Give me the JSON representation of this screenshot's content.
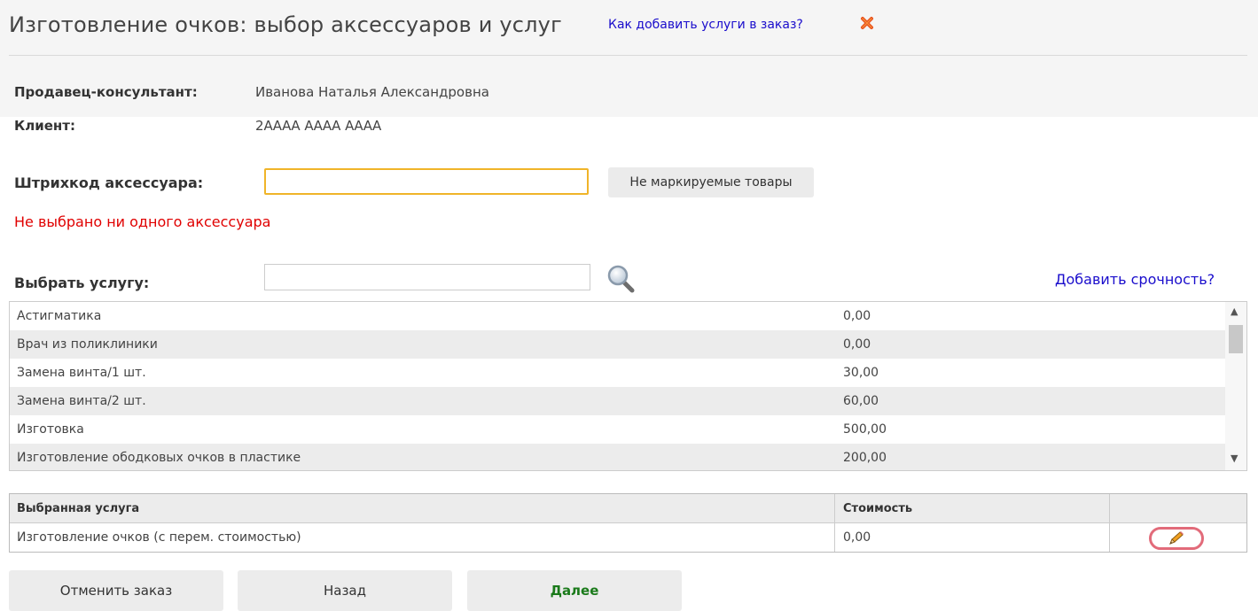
{
  "header": {
    "title": "Изготовление очков: выбор аксессуаров и услуг",
    "help_link": "Как добавить услуги в заказ?",
    "close_icon": "close-x-icon"
  },
  "info": {
    "seller_label": "Продавец-консультант:",
    "seller_value": "Иванова Наталья Александровна",
    "client_label": "Клиент:",
    "client_value": "2АААА АААА АААА"
  },
  "accessory": {
    "barcode_label": "Штрихкод аксессуара:",
    "barcode_value": "",
    "unmarked_button": "Не маркируемые товары",
    "error": "Не выбрано ни одного аксессуара"
  },
  "service": {
    "label": "Выбрать услугу:",
    "search_value": "",
    "search_icon": "magnifier-icon",
    "urgency_link": "Добавить срочность?",
    "list": [
      {
        "name": "Астигматика",
        "price": "0,00"
      },
      {
        "name": "Врач из поликлиники",
        "price": "0,00"
      },
      {
        "name": "Замена винта/1 шт.",
        "price": "30,00"
      },
      {
        "name": "Замена винта/2 шт.",
        "price": "60,00"
      },
      {
        "name": "Изготовка",
        "price": "500,00"
      },
      {
        "name": "Изготовление ободковых очков в пластике",
        "price": "200,00"
      }
    ]
  },
  "selected": {
    "col_service": "Выбранная услуга",
    "col_cost": "Стоимость",
    "rows": [
      {
        "name": "Изготовление очков (с перем. стоимостью)",
        "cost": "0,00",
        "action_icon": "pencil-icon"
      }
    ]
  },
  "buttons": {
    "cancel": "Отменить заказ",
    "back": "Назад",
    "next": "Далее"
  }
}
